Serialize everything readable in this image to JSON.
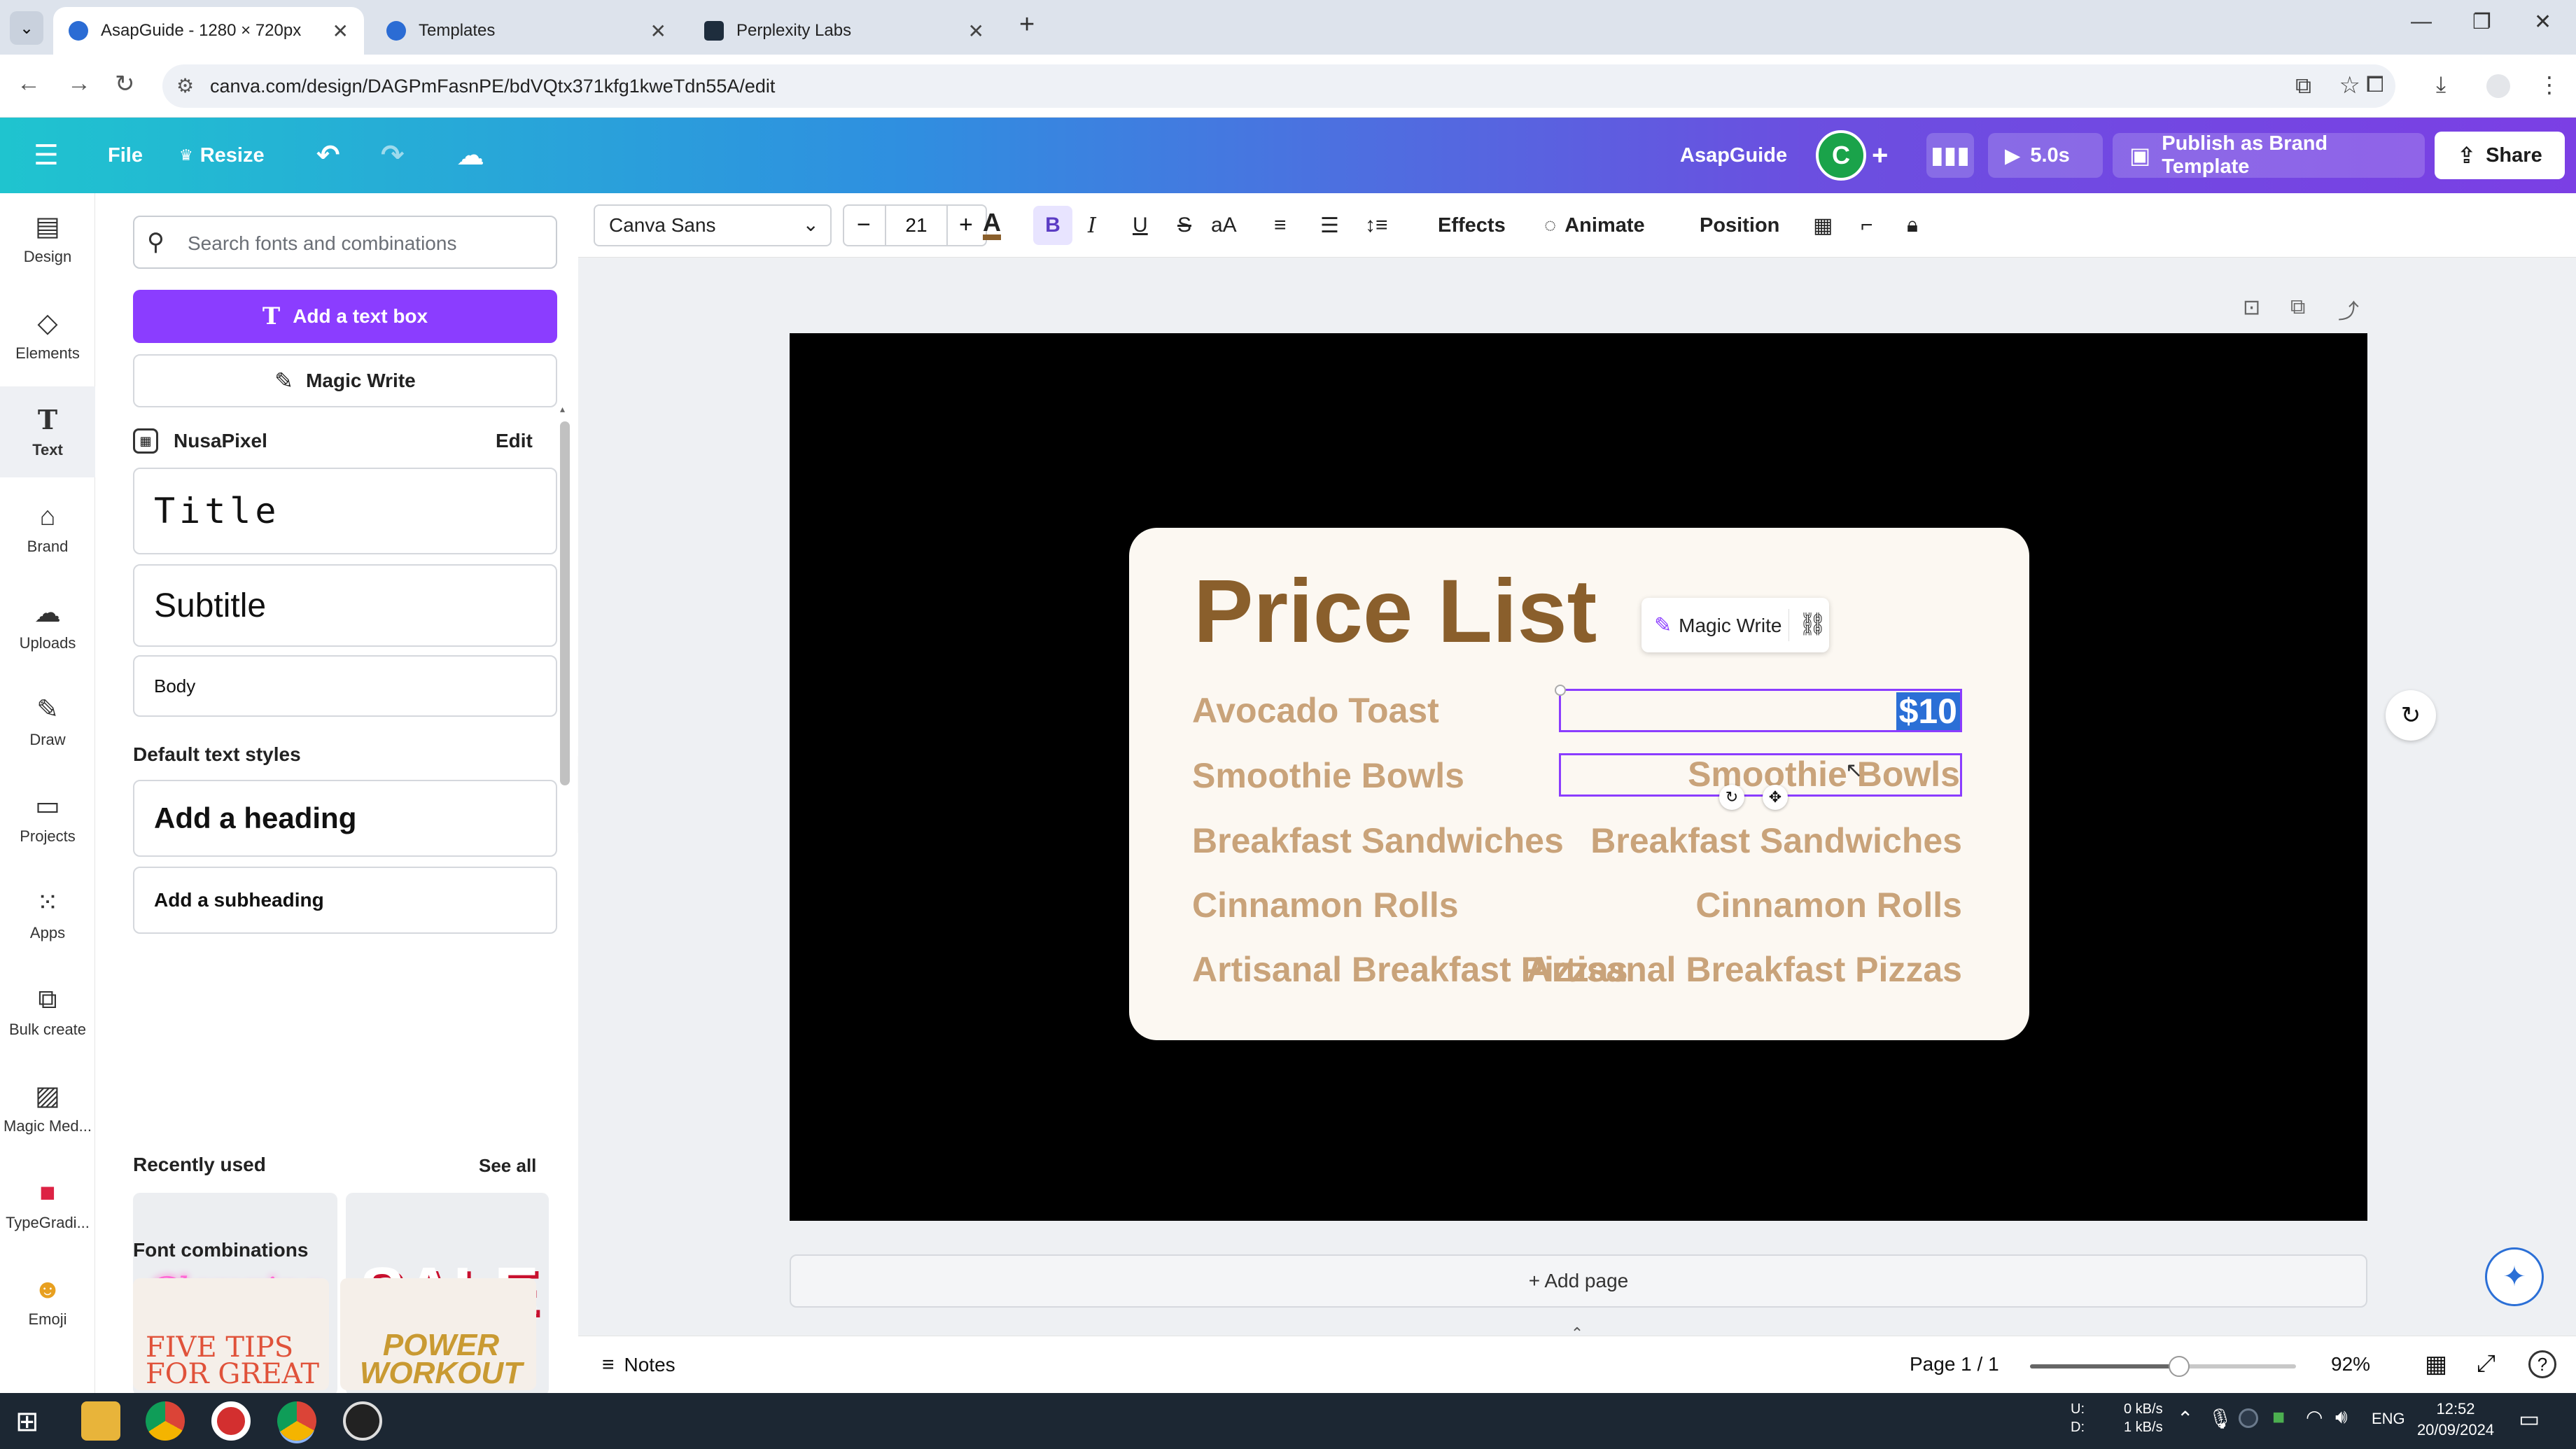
{
  "browser": {
    "tabs": [
      {
        "title": "AsapGuide - 1280 × 720px",
        "active": true
      },
      {
        "title": "Templates",
        "active": false
      },
      {
        "title": "Perplexity Labs",
        "active": false
      }
    ],
    "url": "canva.com/design/DAGPmFasnPE/bdVQtx371kfg1kweTdn55A/edit"
  },
  "topbar": {
    "file": "File",
    "resize": "Resize",
    "project_name": "AsapGuide",
    "avatar_letter": "C",
    "play_duration": "5.0s",
    "publish": "Publish as Brand Template",
    "share": "Share"
  },
  "rail": [
    {
      "label": "Design",
      "icon": "design-icon"
    },
    {
      "label": "Elements",
      "icon": "elements-icon"
    },
    {
      "label": "Text",
      "icon": "text-icon",
      "active": true
    },
    {
      "label": "Brand",
      "icon": "brand-icon"
    },
    {
      "label": "Uploads",
      "icon": "uploads-icon"
    },
    {
      "label": "Draw",
      "icon": "draw-icon"
    },
    {
      "label": "Projects",
      "icon": "projects-icon"
    },
    {
      "label": "Apps",
      "icon": "apps-icon"
    },
    {
      "label": "Bulk create",
      "icon": "bulk-create-icon"
    },
    {
      "label": "Magic Med...",
      "icon": "magic-media-icon"
    },
    {
      "label": "TypeGradi...",
      "icon": "typegradient-icon"
    },
    {
      "label": "Emoji",
      "icon": "emoji-icon"
    }
  ],
  "panel": {
    "search_placeholder": "Search fonts and combinations",
    "add_text_box": "Add a text box",
    "magic_write": "Magic Write",
    "brand_kit": "NusaPixel",
    "brand_edit": "Edit",
    "brand_styles": {
      "title": "Title",
      "subtitle": "Subtitle",
      "body": "Body"
    },
    "default_styles_header": "Default text styles",
    "add_heading": "Add a heading",
    "add_subheading": "Add a subheading",
    "recently_used": "Recently used",
    "see_all": "See all",
    "recent_items": [
      "Glamping",
      "SALE"
    ],
    "font_combinations": "Font combinations",
    "combo_items": [
      "FIVE TIPS FOR GREAT",
      "POWER WORKOUT"
    ]
  },
  "toolbar": {
    "font": "Canva Sans",
    "font_size": "21",
    "effects": "Effects",
    "animate": "Animate",
    "position": "Position"
  },
  "canvas": {
    "title": "Price List",
    "magic_write_popup": "Magic Write",
    "items_left": [
      "Avocado Toast",
      "Smoothie Bowls",
      "Breakfast Sandwiches",
      "Cinnamon Rolls",
      "Artisanal Breakfast Pizzas"
    ],
    "items_right": [
      "$10",
      "Smoothie Bowls",
      "Breakfast Sandwiches",
      "Cinnamon Rolls",
      "Artisanal Breakfast Pizzas"
    ],
    "add_page": "+ Add page"
  },
  "bottombar": {
    "notes": "Notes",
    "page": "Page 1 / 1",
    "zoom": "92%",
    "zoom_level": 0.56
  },
  "taskbar": {
    "net_up_label": "U:",
    "net_down_label": "D:",
    "net_up": "0 kB/s",
    "net_down": "1 kB/s",
    "lang": "ENG",
    "time": "12:52",
    "date": "20/09/2024"
  },
  "colors": {
    "accent": "#8b3dff",
    "menu_text": "#c9a37a",
    "title_text": "#8a5f2c",
    "selection": "#8b3dff"
  }
}
